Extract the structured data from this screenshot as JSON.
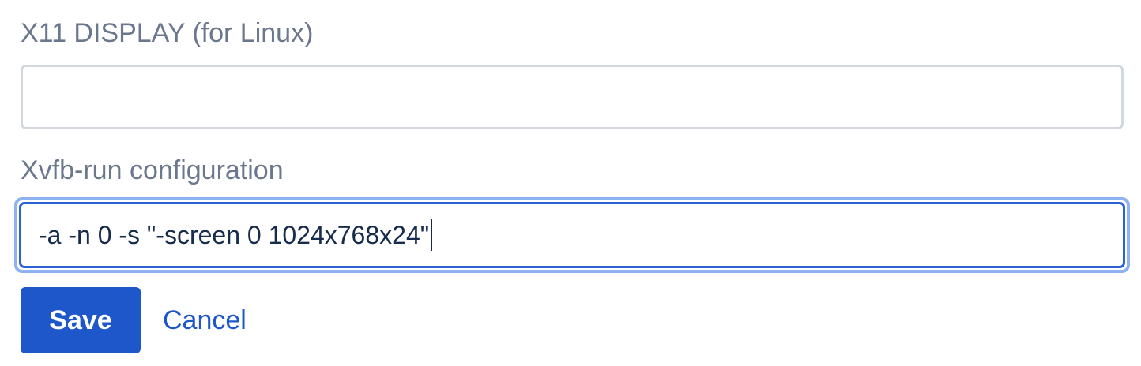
{
  "form": {
    "display_field": {
      "label": "X11 DISPLAY (for Linux)",
      "value": ""
    },
    "xvfb_field": {
      "label": "Xvfb-run configuration",
      "value": "-a -n 0 -s \"-screen 0 1024x768x24\""
    },
    "actions": {
      "save_label": "Save",
      "cancel_label": "Cancel"
    }
  },
  "colors": {
    "label": "#6b778c",
    "primary": "#1d57c9",
    "input_border": "#d3d8df",
    "focus_ring": "#8fb3f0",
    "text": "#172b4d"
  }
}
